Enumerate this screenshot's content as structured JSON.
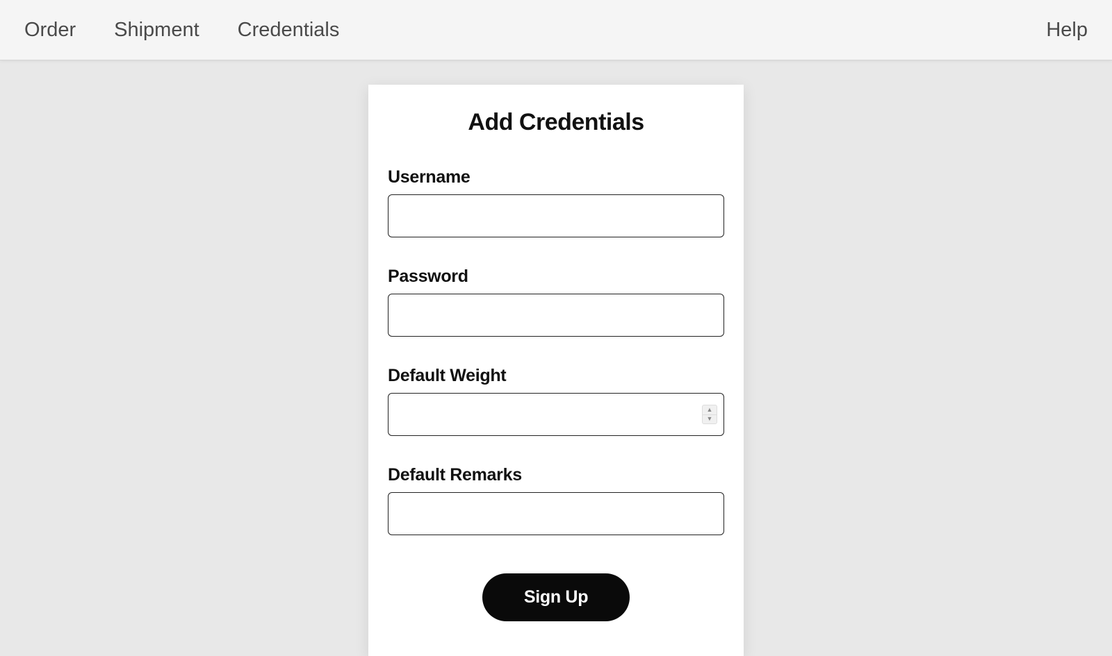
{
  "nav": {
    "items": [
      "Order",
      "Shipment",
      "Credentials"
    ],
    "help": "Help"
  },
  "form": {
    "title": "Add Credentials",
    "fields": {
      "username": {
        "label": "Username",
        "value": ""
      },
      "password": {
        "label": "Password",
        "value": ""
      },
      "defaultWeight": {
        "label": "Default Weight",
        "value": ""
      },
      "defaultRemarks": {
        "label": "Default Remarks",
        "value": ""
      }
    },
    "submitLabel": "Sign Up"
  }
}
